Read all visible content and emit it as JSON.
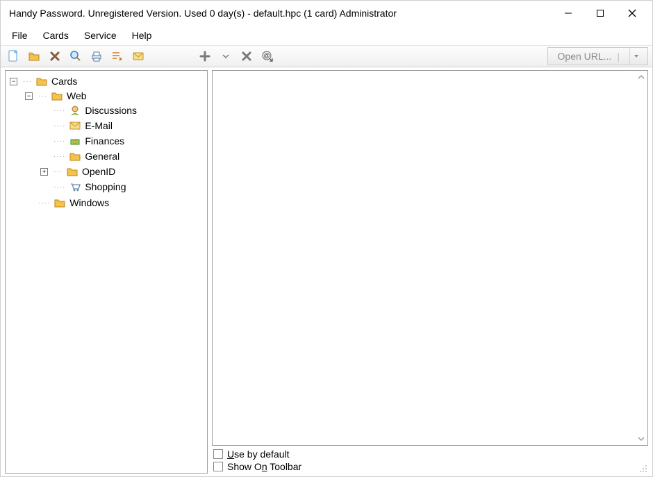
{
  "window": {
    "title": "Handy Password. Unregistered Version. Used 0 day(s) - default.hpc (1 card) Administrator"
  },
  "menu": {
    "file": "File",
    "cards": "Cards",
    "service": "Service",
    "help": "Help"
  },
  "toolbar": {
    "open_url_label": "Open URL..."
  },
  "tree": {
    "root": "Cards",
    "web": "Web",
    "discussions": "Discussions",
    "email": "E-Mail",
    "finances": "Finances",
    "general": "General",
    "openid": "OpenID",
    "shopping": "Shopping",
    "windows": "Windows"
  },
  "footer": {
    "use_default_pre": "U",
    "use_default_post": "se by default",
    "show_toolbar_pre": "Show O",
    "show_toolbar_post": "n Toolbar"
  }
}
